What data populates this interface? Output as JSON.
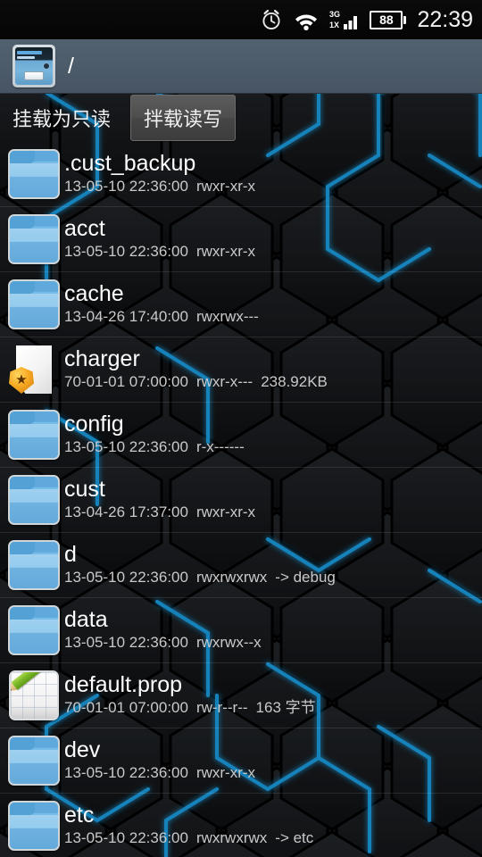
{
  "statusbar": {
    "icons": [
      "alarm-clock-icon",
      "wifi-icon",
      "signal-3g-1x-icon",
      "battery-icon"
    ],
    "signal_label_top": "3G",
    "signal_label_bottom": "1X",
    "battery_level": "88",
    "time": "22:39"
  },
  "actionbar": {
    "app_icon": "file-cabinet-icon",
    "path": "/"
  },
  "mountbar": {
    "read_only_label": "挂载为只读",
    "read_write_label": "拌载读写"
  },
  "colors": {
    "actionbar_bg": "#4c5b69",
    "accent_blue": "#1b9ae0",
    "folder_blue": "#5fa9dc",
    "badge_orange": "#f7a823",
    "pencil_green": "#7cb928",
    "text_primary": "#ffffff",
    "text_secondary": "#c9c9c9"
  },
  "files": [
    {
      "icon": "folder-icon",
      "name": ".cust_backup",
      "date": "13-05-10 22:36:00",
      "perms": "rwxr-xr-x",
      "extra": ""
    },
    {
      "icon": "folder-icon",
      "name": "acct",
      "date": "13-05-10 22:36:00",
      "perms": "rwxr-xr-x",
      "extra": ""
    },
    {
      "icon": "folder-icon",
      "name": "cache",
      "date": "13-04-26 17:40:00",
      "perms": "rwxrwx---",
      "extra": ""
    },
    {
      "icon": "file-badge-icon",
      "name": "charger",
      "date": "70-01-01 07:00:00",
      "perms": "rwxr-x---",
      "extra": "238.92KB"
    },
    {
      "icon": "folder-icon",
      "name": "config",
      "date": "13-05-10 22:36:00",
      "perms": "r-x------",
      "extra": ""
    },
    {
      "icon": "folder-icon",
      "name": "cust",
      "date": "13-04-26 17:37:00",
      "perms": "rwxr-xr-x",
      "extra": ""
    },
    {
      "icon": "folder-icon",
      "name": "d",
      "date": "13-05-10 22:36:00",
      "perms": "rwxrwxrwx",
      "extra": "-> debug"
    },
    {
      "icon": "folder-icon",
      "name": "data",
      "date": "13-05-10 22:36:00",
      "perms": "rwxrwx--x",
      "extra": ""
    },
    {
      "icon": "notepad-pencil-icon",
      "name": "default.prop",
      "date": "70-01-01 07:00:00",
      "perms": "rw-r--r--",
      "extra": "163 字节"
    },
    {
      "icon": "folder-icon",
      "name": "dev",
      "date": "13-05-10 22:36:00",
      "perms": "rwxr-xr-x",
      "extra": ""
    },
    {
      "icon": "folder-icon",
      "name": "etc",
      "date": "13-05-10 22:36:00",
      "perms": "rwxrwxrwx",
      "extra": "-> etc"
    }
  ]
}
